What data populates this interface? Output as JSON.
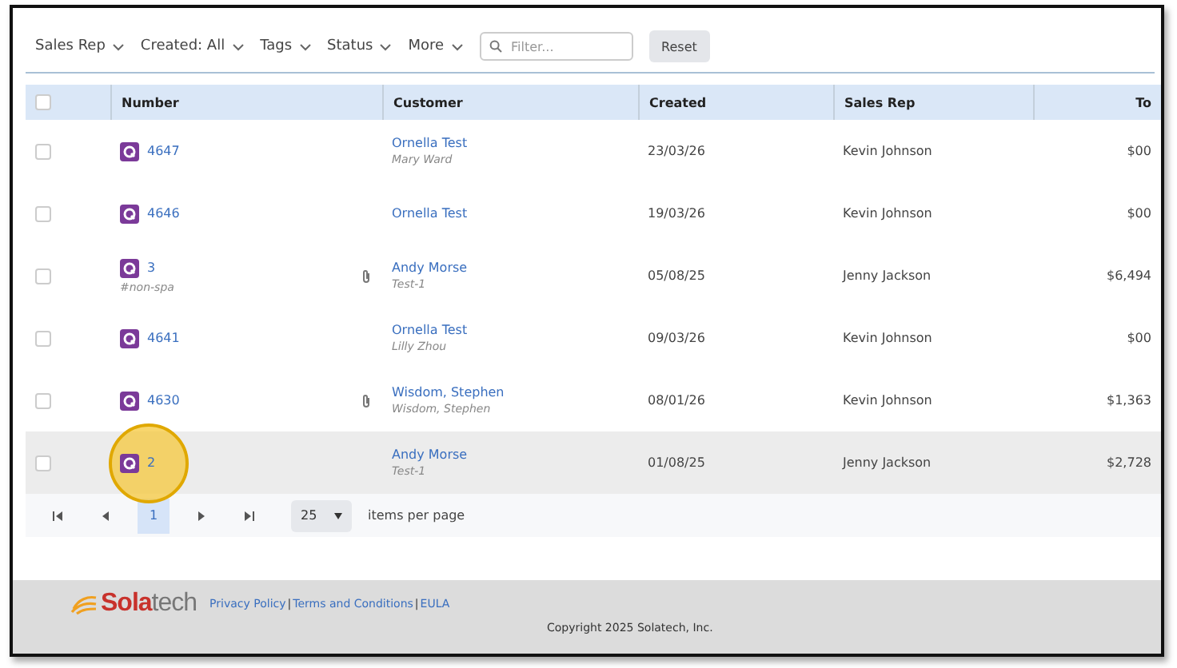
{
  "toolbar": {
    "filters": [
      "Sales Rep",
      "Created: All",
      "Tags",
      "Status",
      "More"
    ],
    "search": {
      "placeholder": "Filter..."
    },
    "reset_button": "Reset"
  },
  "table": {
    "select_all": {
      "checked": false
    },
    "columns": [
      "Number",
      "Customer",
      "Created",
      "Sales Rep",
      "To"
    ],
    "rows": [
      {
        "checked": false,
        "hovered": false,
        "click_marker": false,
        "number": "4647",
        "tag": "",
        "attachment": false,
        "customer": "Ornella Test",
        "contact": "Mary Ward",
        "created": "23/03/26",
        "sales_rep": "Kevin Johnson",
        "total": "$00"
      },
      {
        "checked": false,
        "hovered": false,
        "click_marker": false,
        "number": "4646",
        "tag": "",
        "attachment": false,
        "customer": "Ornella Test",
        "contact": "",
        "created": "19/03/26",
        "sales_rep": "Kevin Johnson",
        "total": "$00"
      },
      {
        "checked": false,
        "hovered": false,
        "click_marker": false,
        "number": "3",
        "tag": "#non-spa",
        "attachment": true,
        "customer": "Andy Morse",
        "contact": "Test-1",
        "created": "05/08/25",
        "sales_rep": "Jenny Jackson",
        "total": "$6,494"
      },
      {
        "checked": false,
        "hovered": false,
        "click_marker": false,
        "number": "4641",
        "tag": "",
        "attachment": false,
        "customer": "Ornella Test",
        "contact": "Lilly Zhou",
        "created": "09/03/26",
        "sales_rep": "Kevin Johnson",
        "total": "$00"
      },
      {
        "checked": false,
        "hovered": false,
        "click_marker": false,
        "number": "4630",
        "tag": "",
        "attachment": true,
        "customer": "Wisdom, Stephen",
        "contact": "Wisdom, Stephen",
        "created": "08/01/26",
        "sales_rep": "Kevin Johnson",
        "total": "$1,363"
      },
      {
        "checked": false,
        "hovered": true,
        "click_marker": true,
        "number": "2",
        "tag": "",
        "attachment": false,
        "customer": "Andy Morse",
        "contact": "Test-1",
        "created": "01/08/25",
        "sales_rep": "Jenny Jackson",
        "total": "$2,728"
      }
    ]
  },
  "pager": {
    "current_page": "1",
    "page_size": "25",
    "label": "items per page"
  },
  "footer": {
    "logo": {
      "first": "Sola",
      "second": "tech"
    },
    "links": [
      "Privacy Policy",
      "Terms and Conditions",
      "EULA"
    ],
    "separator": "|",
    "copyright": "Copyright 2025 Solatech, Inc."
  }
}
